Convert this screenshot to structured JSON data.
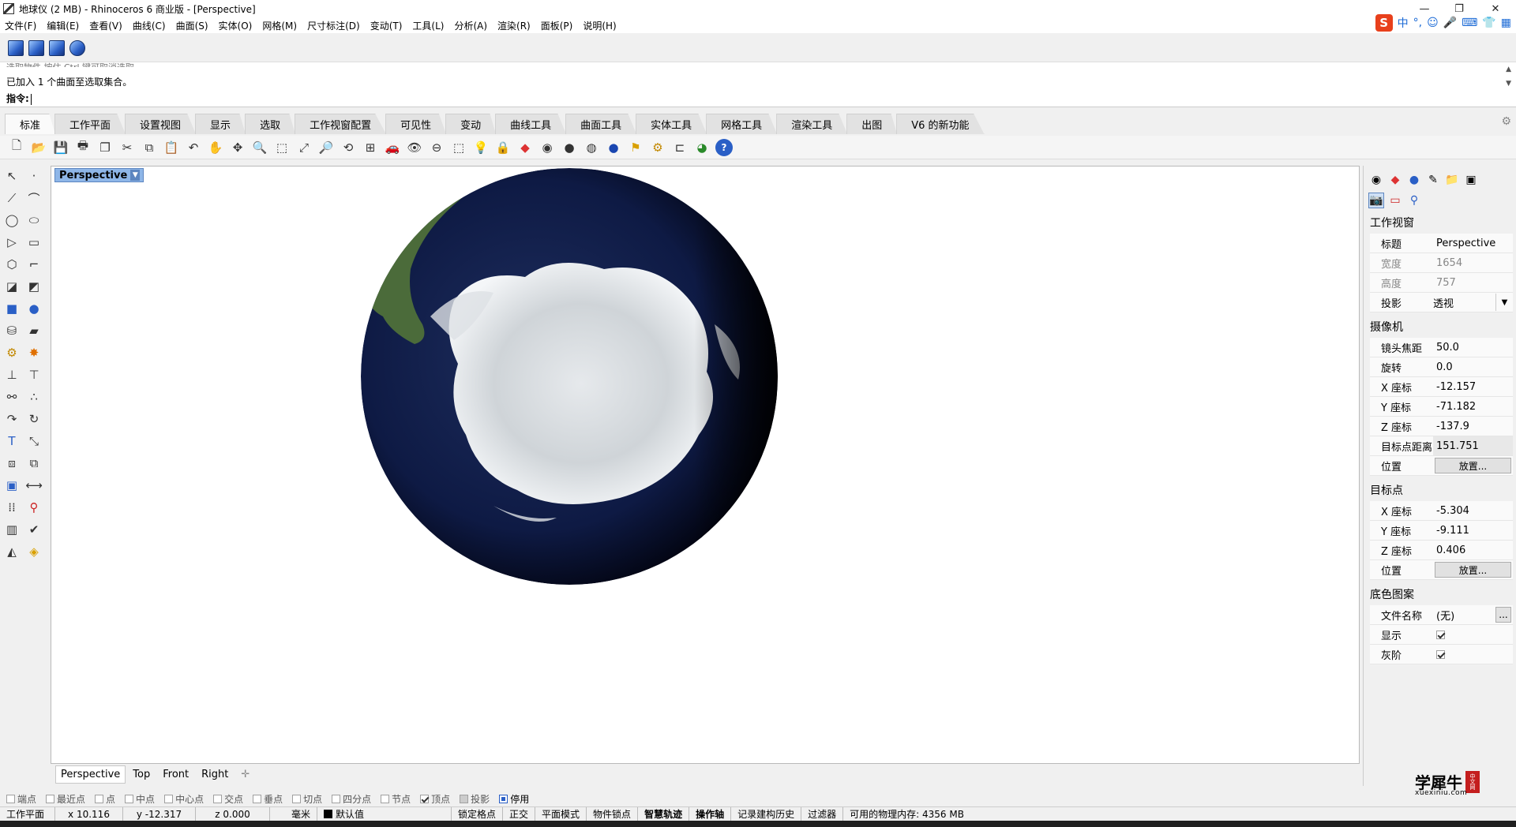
{
  "window": {
    "title": "地球仪 (2 MB) - Rhinoceros 6 商业版 - [Perspective]"
  },
  "menu": [
    "文件(F)",
    "编辑(E)",
    "查看(V)",
    "曲线(C)",
    "曲面(S)",
    "实体(O)",
    "网格(M)",
    "尺寸标注(D)",
    "变动(T)",
    "工具(L)",
    "分析(A)",
    "渲染(R)",
    "面板(P)",
    "说明(H)"
  ],
  "ime": {
    "logo": "S",
    "lang": "中"
  },
  "command": {
    "history_line": "已加入 1 个曲面至选取集合。",
    "prompt": "指令:"
  },
  "tabs": [
    "标准",
    "工作平面",
    "设置视图",
    "显示",
    "选取",
    "工作视窗配置",
    "可见性",
    "变动",
    "曲线工具",
    "曲面工具",
    "实体工具",
    "网格工具",
    "渲染工具",
    "出图",
    "V6 的新功能"
  ],
  "active_tab": "标准",
  "viewport": {
    "title": "Perspective"
  },
  "view_tabs": [
    "Perspective",
    "Top",
    "Front",
    "Right"
  ],
  "osnaps": [
    {
      "label": "端点",
      "checked": false
    },
    {
      "label": "最近点",
      "checked": false
    },
    {
      "label": "点",
      "checked": false
    },
    {
      "label": "中点",
      "checked": false
    },
    {
      "label": "中心点",
      "checked": false
    },
    {
      "label": "交点",
      "checked": false
    },
    {
      "label": "垂点",
      "checked": false
    },
    {
      "label": "切点",
      "checked": false
    },
    {
      "label": "四分点",
      "checked": false
    },
    {
      "label": "节点",
      "checked": false
    },
    {
      "label": "顶点",
      "checked": true
    },
    {
      "label": "投影",
      "checked": false
    },
    {
      "label": "停用",
      "checked": false
    }
  ],
  "status": {
    "cplane": "工作平面",
    "x": "x 10.116",
    "y": "y -12.317",
    "z": "z 0.000",
    "unit": "毫米",
    "layer": "默认值",
    "lock_grid": "锁定格点",
    "ortho": "正交",
    "planar": "平面模式",
    "osnap": "物件锁点",
    "smarttrack": "智慧轨迹",
    "gumball": "操作轴",
    "history": "记录建构历史",
    "filter": "过滤器",
    "memory": "可用的物理内存: 4356 MB"
  },
  "properties": {
    "viewport_section": "工作视窗",
    "title_label": "标题",
    "title_value": "Perspective",
    "width_label": "宽度",
    "width_value": "1654",
    "height_label": "高度",
    "height_value": "757",
    "projection_label": "投影",
    "projection_value": "透视",
    "camera_section": "摄像机",
    "lens_label": "镜头焦距",
    "lens_value": "50.0",
    "rotation_label": "旋转",
    "rotation_value": "0.0",
    "cam_x_label": "X 座标",
    "cam_x_value": "-12.157",
    "cam_y_label": "Y 座标",
    "cam_y_value": "-71.182",
    "cam_z_label": "Z 座标",
    "cam_z_value": "-137.9",
    "target_dist_label": "目标点距离",
    "target_dist_value": "151.751",
    "position_label": "位置",
    "place_button": "放置...",
    "target_section": "目标点",
    "tgt_x_label": "X 座标",
    "tgt_x_value": "-5.304",
    "tgt_y_label": "Y 座标",
    "tgt_y_value": "-9.111",
    "tgt_z_label": "Z 座标",
    "tgt_z_value": "0.406",
    "tgt_position_label": "位置",
    "tgt_place_button": "放置...",
    "wallpaper_section": "底色图案",
    "file_label": "文件名称",
    "file_value": "(无)",
    "browse_button": "...",
    "show_label": "显示",
    "show_checked": true,
    "gray_label": "灰阶",
    "gray_checked": true
  },
  "watermark": {
    "brand": "学犀牛",
    "url": "xuexiniu.com",
    "seal": "中文网"
  }
}
